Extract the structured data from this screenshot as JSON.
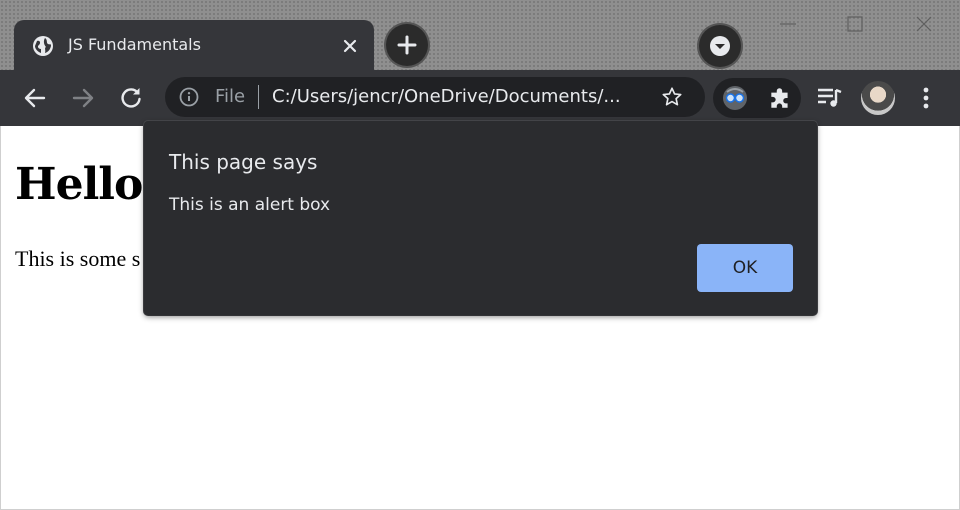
{
  "window": {
    "controls": {
      "minimize_icon": "minimize-icon",
      "maximize_icon": "maximize-icon",
      "close_icon": "close-icon"
    }
  },
  "tabs": [
    {
      "title": "JS Fundamentals",
      "favicon": "globe-icon",
      "active": true
    }
  ],
  "toolbar": {
    "scheme_label": "File",
    "url": "C:/Users/jencr/OneDrive/Documents/...",
    "icons": [
      "back-arrow-icon",
      "forward-arrow-icon",
      "reload-icon",
      "info-icon",
      "star-icon",
      "extension-icon",
      "puzzle-icon",
      "media-queue-icon",
      "avatar",
      "kebab-menu-icon"
    ]
  },
  "page": {
    "heading": "Hello W",
    "paragraph": "This is some s"
  },
  "dialog": {
    "title": "This page says",
    "message": "This is an alert box",
    "ok_label": "OK"
  },
  "colors": {
    "tab_strip": "#8f8f8f",
    "toolbar": "#35363a",
    "omnibox": "#202124",
    "dialog_bg": "#2b2c2f",
    "accent": "#8ab4f8",
    "text_light": "#e8eaed"
  }
}
